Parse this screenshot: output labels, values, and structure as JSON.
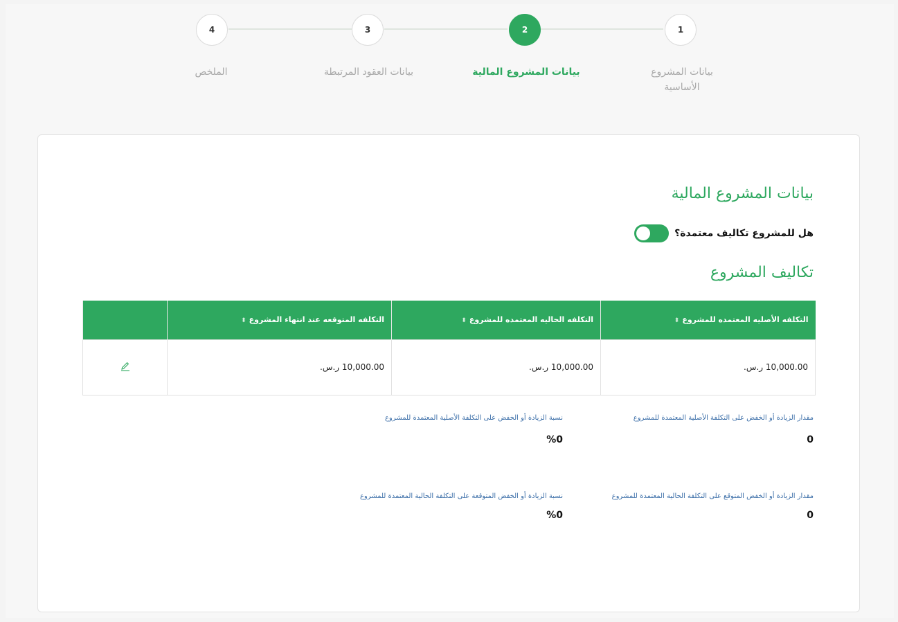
{
  "stepper": {
    "steps": [
      {
        "number": "1",
        "label": "بيانات المشروع الأساسية",
        "state": "default"
      },
      {
        "number": "2",
        "label": "بيانات المشروع المالية",
        "state": "active"
      },
      {
        "number": "3",
        "label": "بيانات العقود المرتبطة",
        "state": "default"
      },
      {
        "number": "4",
        "label": "الملخص",
        "state": "default"
      }
    ]
  },
  "form": {
    "title": "بيانات المشروع المالية",
    "toggle_label": "هل للمشروع تكاليف معتمدة؟",
    "toggle_on": true,
    "costs_title": "تكاليف المشروع"
  },
  "table": {
    "headers": [
      "التكلفه الأصليه المعتمده للمشروع",
      "التكلفه الحاليه المعتمده للمشروع",
      "التكلفه المتوقعه عند انتهاء المشروع"
    ],
    "rows": [
      [
        "10,000.00 ر.س.",
        "10,000.00 ر.س.",
        "10,000.00 ر.س."
      ]
    ]
  },
  "stats": {
    "orig_change_amount_label": "مقدار الزيادة أو الخفض على التكلفة الأصلية المعتمدة للمشروع",
    "orig_change_amount_value": "0",
    "orig_change_pct_label": "نسبة الزيادة أو الخفض على التكلفة الأصلية المعتمدة للمشروع",
    "orig_change_pct_value": "%0",
    "expected_change_amount_label": "مقدار الزيادة أو الخفض المتوقع على التكلفة الحالية المعتمدة للمشروع",
    "expected_change_amount_value": "0",
    "expected_change_pct_label": "نسبة الزيادة أو الخفض المتوقعة على التكلفة الحالية المعتمدة للمشروع",
    "expected_change_pct_value": "%0"
  },
  "colors": {
    "accent": "#2ea85f",
    "label_blue": "#3b6ea8"
  },
  "icons": {
    "edit": "pencil-icon",
    "sort": "sort-icon"
  }
}
